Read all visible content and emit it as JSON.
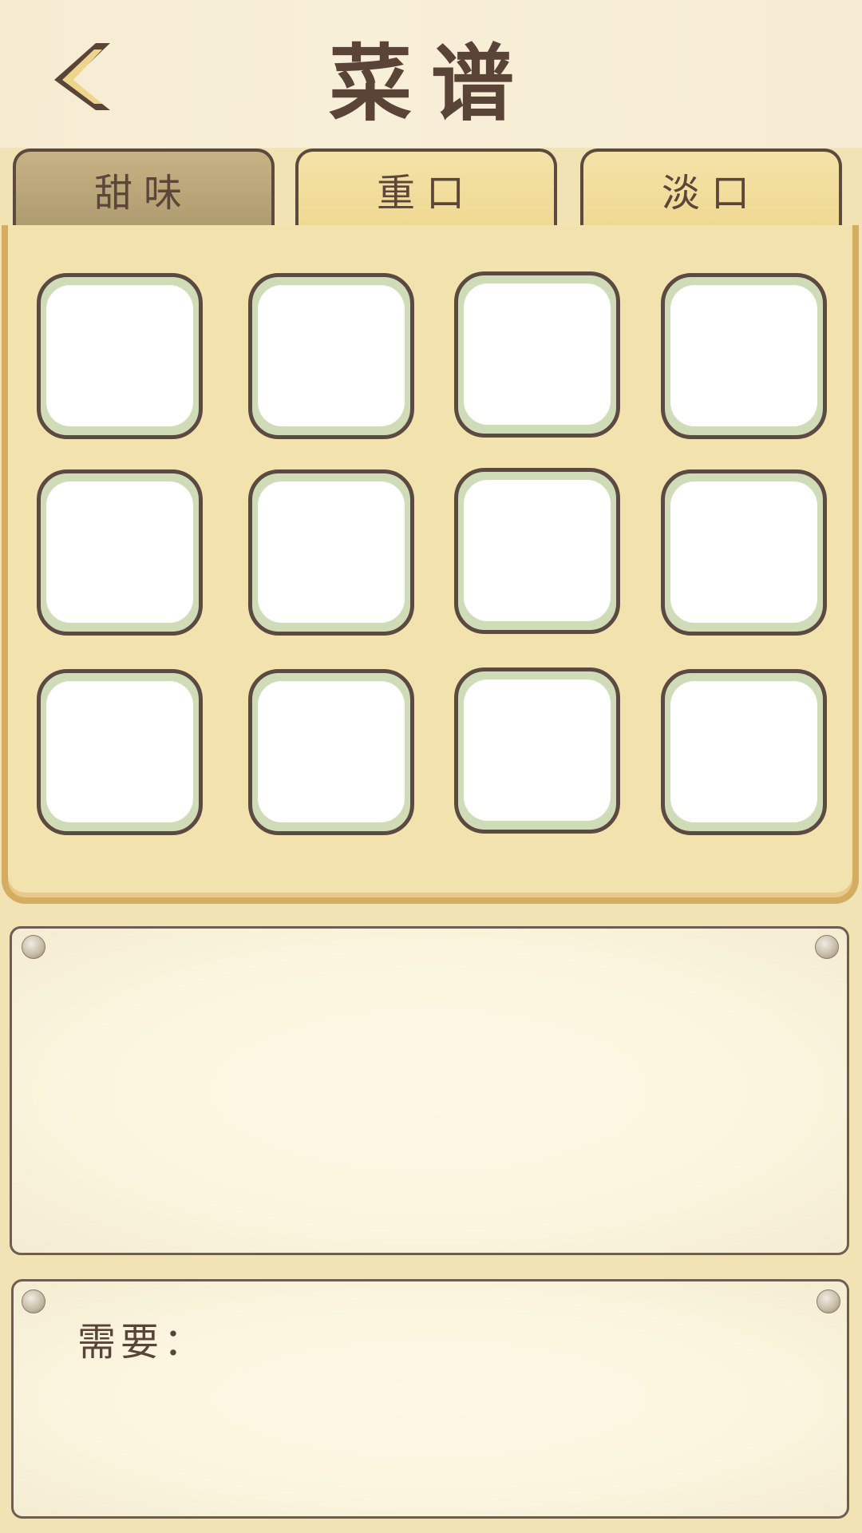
{
  "header": {
    "title": "菜谱",
    "back_icon": "chevron-left-icon"
  },
  "tabs": [
    {
      "label": "甜味",
      "active": true
    },
    {
      "label": "重口",
      "active": false
    },
    {
      "label": "淡口",
      "active": false
    }
  ],
  "recipe_grid": {
    "rows": 3,
    "columns": 4,
    "slots": [
      "",
      "",
      "",
      "",
      "",
      "",
      "",
      "",
      "",
      "",
      "",
      ""
    ]
  },
  "detail_panel": {
    "text": ""
  },
  "requirements_panel": {
    "label": "需要："
  },
  "colors": {
    "background": "#f2e3b4",
    "text": "#5a4438",
    "tab_active": "#b4a274",
    "tab_inactive": "#f1dd9c",
    "slot_border": "#5b4a42",
    "slot_rim": "#cfdcb7",
    "panel_border": "#d4ac62"
  }
}
